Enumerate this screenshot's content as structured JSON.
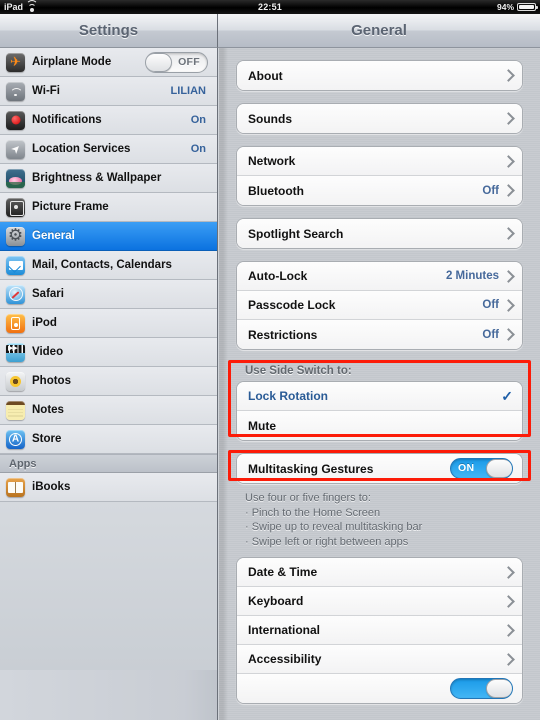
{
  "statusbar": {
    "device": "iPad",
    "wifi_icon": "wifi-icon",
    "time": "22:51",
    "battery_percent": "94%",
    "battery_icon": "battery-icon"
  },
  "titlebar": {
    "left_title": "Settings",
    "right_title": "General"
  },
  "sidebar": {
    "items": [
      {
        "label": "Airplane Mode",
        "icon": "airplane-icon",
        "control": "toggle",
        "toggle_state": "off",
        "toggle_label": "OFF"
      },
      {
        "label": "Wi-Fi",
        "icon": "wifi-icon",
        "value": "LILIAN"
      },
      {
        "label": "Notifications",
        "icon": "notifications-icon",
        "value": "On"
      },
      {
        "label": "Location Services",
        "icon": "location-icon",
        "value": "On"
      },
      {
        "label": "Brightness & Wallpaper",
        "icon": "brightness-icon",
        "value": ""
      },
      {
        "label": "Picture Frame",
        "icon": "picture-frame-icon",
        "value": ""
      },
      {
        "label": "General",
        "icon": "gear-icon",
        "value": "",
        "selected": true
      },
      {
        "label": "Mail, Contacts, Calendars",
        "icon": "mail-icon",
        "value": ""
      },
      {
        "label": "Safari",
        "icon": "safari-icon",
        "value": ""
      },
      {
        "label": "iPod",
        "icon": "ipod-icon",
        "value": ""
      },
      {
        "label": "Video",
        "icon": "video-icon",
        "value": ""
      },
      {
        "label": "Photos",
        "icon": "photos-icon",
        "value": ""
      },
      {
        "label": "Notes",
        "icon": "notes-icon",
        "value": ""
      },
      {
        "label": "Store",
        "icon": "store-icon",
        "value": ""
      }
    ],
    "apps_header": "Apps",
    "apps": [
      {
        "label": "iBooks",
        "icon": "ibooks-icon"
      }
    ]
  },
  "general": {
    "group_about": [
      {
        "label": "About",
        "value": "",
        "chevron": true
      }
    ],
    "group_sounds": [
      {
        "label": "Sounds",
        "value": "",
        "chevron": true
      }
    ],
    "group_network": [
      {
        "label": "Network",
        "value": "",
        "chevron": true
      },
      {
        "label": "Bluetooth",
        "value": "Off",
        "chevron": true
      }
    ],
    "group_spotlight": [
      {
        "label": "Spotlight Search",
        "value": "",
        "chevron": true
      }
    ],
    "group_lock": [
      {
        "label": "Auto-Lock",
        "value": "2 Minutes",
        "chevron": true
      },
      {
        "label": "Passcode Lock",
        "value": "Off",
        "chevron": true
      },
      {
        "label": "Restrictions",
        "value": "Off",
        "chevron": true
      }
    ],
    "side_switch_header": "Use Side Switch to:",
    "side_switch_options": [
      {
        "label": "Lock Rotation",
        "selected": true,
        "check_glyph": "✓"
      },
      {
        "label": "Mute",
        "selected": false,
        "check_glyph": ""
      }
    ],
    "multitasking": {
      "label": "Multitasking Gestures",
      "toggle_state": "on",
      "toggle_label": "ON"
    },
    "multitasking_footnote": [
      "Use four or five fingers to:",
      "· Pinch to the Home Screen",
      "· Swipe up to reveal multitasking bar",
      "· Swipe left or right between apps"
    ],
    "group_datetime": [
      {
        "label": "Date & Time",
        "value": "",
        "chevron": true
      },
      {
        "label": "Keyboard",
        "value": "",
        "chevron": true
      },
      {
        "label": "International",
        "value": "",
        "chevron": true
      },
      {
        "label": "Accessibility",
        "value": "",
        "chevron": true
      }
    ]
  },
  "colors": {
    "selection_blue": "#0b72e0",
    "value_blue": "#46699b",
    "annotation_red": "#fc1b08",
    "toggle_on_blue": "#1a9ae8"
  }
}
